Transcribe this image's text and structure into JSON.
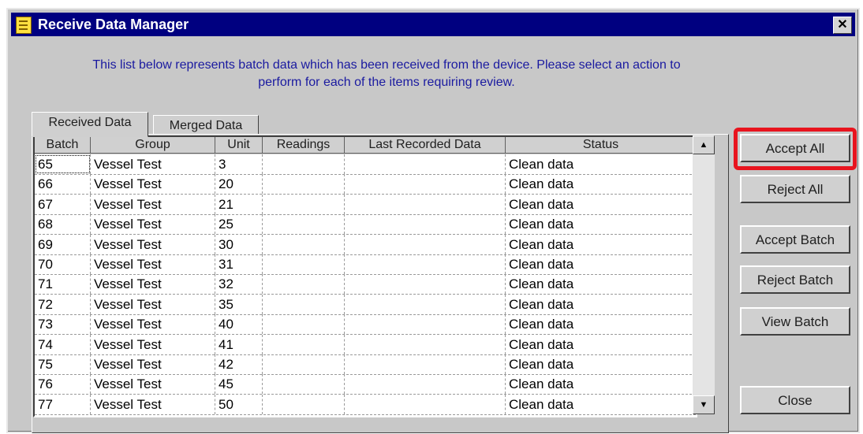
{
  "window": {
    "title": "Receive Data Manager",
    "close_glyph": "✕"
  },
  "intro": {
    "line1": "This list below represents batch data which has been received from the device.  Please select an action to",
    "line2": "perform for each of the items requiring review."
  },
  "tabs": [
    {
      "label": "Received Data",
      "active": true
    },
    {
      "label": "Merged Data",
      "active": false
    }
  ],
  "grid": {
    "columns": [
      "Batch",
      "Group",
      "Unit",
      "Readings",
      "Last Recorded Data",
      "Status"
    ],
    "rows": [
      [
        "65",
        "Vessel Test",
        "3",
        "",
        "",
        "Clean data"
      ],
      [
        "66",
        "Vessel Test",
        "20",
        "",
        "",
        "Clean data"
      ],
      [
        "67",
        "Vessel Test",
        "21",
        "",
        "",
        "Clean data"
      ],
      [
        "68",
        "Vessel Test",
        "25",
        "",
        "",
        "Clean data"
      ],
      [
        "69",
        "Vessel Test",
        "30",
        "",
        "",
        "Clean data"
      ],
      [
        "70",
        "Vessel Test",
        "31",
        "",
        "",
        "Clean data"
      ],
      [
        "71",
        "Vessel Test",
        "32",
        "",
        "",
        "Clean data"
      ],
      [
        "72",
        "Vessel Test",
        "35",
        "",
        "",
        "Clean data"
      ],
      [
        "73",
        "Vessel Test",
        "40",
        "",
        "",
        "Clean data"
      ],
      [
        "74",
        "Vessel Test",
        "41",
        "",
        "",
        "Clean data"
      ],
      [
        "75",
        "Vessel Test",
        "42",
        "",
        "",
        "Clean data"
      ],
      [
        "76",
        "Vessel Test",
        "45",
        "",
        "",
        "Clean data"
      ],
      [
        "77",
        "Vessel Test",
        "50",
        "",
        "",
        "Clean data"
      ]
    ]
  },
  "scroll": {
    "up_icon": "▲",
    "down_icon": "▼"
  },
  "buttons": {
    "accept_all": "Accept All",
    "reject_all": "Reject All",
    "accept_batch": "Accept Batch",
    "reject_batch": "Reject Batch",
    "view_batch": "View Batch",
    "close": "Close"
  },
  "colors": {
    "title_bar": "#000080",
    "intro_text": "#1a1aa0",
    "highlight": "#e8141e"
  }
}
